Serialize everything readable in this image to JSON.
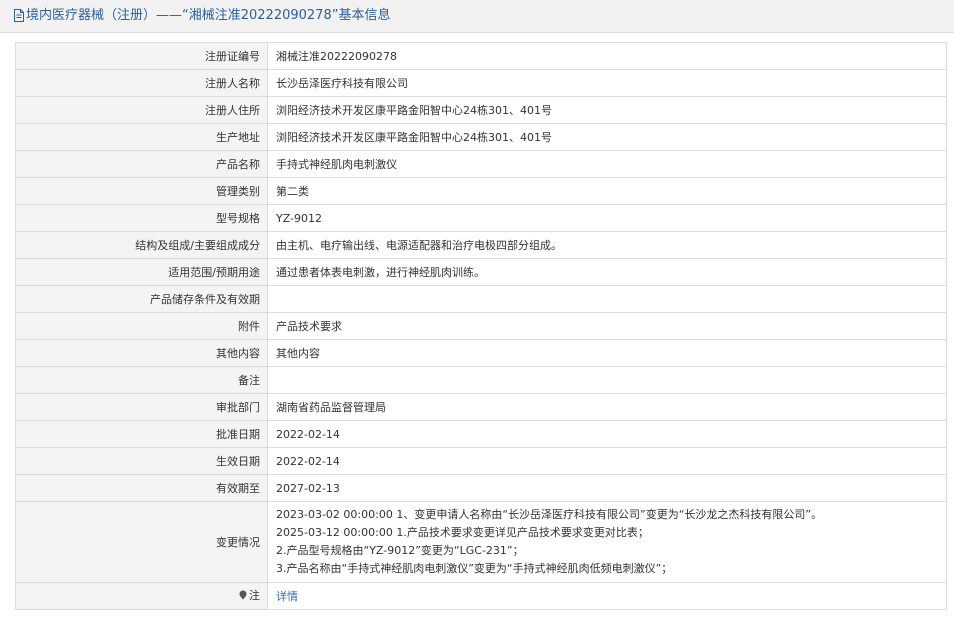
{
  "header": {
    "title": "境内医疗器械（注册）——“湘械注准20222090278”基本信息",
    "icon": "document-icon"
  },
  "rows": [
    {
      "label": "注册证编号",
      "value": "湘械注准20222090278"
    },
    {
      "label": "注册人名称",
      "value": "长沙岳泽医疗科技有限公司"
    },
    {
      "label": "注册人住所",
      "value": "浏阳经济技术开发区康平路金阳智中心24栋301、401号"
    },
    {
      "label": "生产地址",
      "value": "浏阳经济技术开发区康平路金阳智中心24栋301、401号"
    },
    {
      "label": "产品名称",
      "value": "手持式神经肌肉电刺激仪"
    },
    {
      "label": "管理类别",
      "value": "第二类"
    },
    {
      "label": "型号规格",
      "value": "YZ-9012"
    },
    {
      "label": "结构及组成/主要组成成分",
      "value": "由主机、电疗输出线、电源适配器和治疗电极四部分组成。"
    },
    {
      "label": "适用范围/预期用途",
      "value": "通过患者体表电刺激，进行神经肌肉训练。"
    },
    {
      "label": "产品储存条件及有效期",
      "value": ""
    },
    {
      "label": "附件",
      "value": "产品技术要求"
    },
    {
      "label": "其他内容",
      "value": "其他内容"
    },
    {
      "label": "备注",
      "value": ""
    },
    {
      "label": "审批部门",
      "value": "湖南省药品监督管理局"
    },
    {
      "label": "批准日期",
      "value": "2022-02-14"
    },
    {
      "label": "生效日期",
      "value": "2022-02-14"
    },
    {
      "label": "有效期至",
      "value": "2027-02-13"
    }
  ],
  "changes": {
    "label": "变更情况",
    "lines": [
      "2023-03-02 00:00:00 1、变更申请人名称由“长沙岳泽医疗科技有限公司”变更为“长沙龙之杰科技有限公司”。",
      "2025-03-12 00:00:00 1.产品技术要求变更详见产品技术要求变更对比表；",
      "2.产品型号规格由“YZ-9012”变更为“LGC-231”；",
      "3.产品名称由“手持式神经肌肉电刺激仪”变更为“手持式神经肌肉低频电刺激仪”；"
    ]
  },
  "note": {
    "label": "注",
    "icon": "map-pin-icon",
    "link_text": "详情"
  },
  "colors": {
    "title": "#2b5f9e",
    "link": "#2e6fb7",
    "label_bg": "#f4f4f4",
    "border": "#dcdcdc"
  }
}
